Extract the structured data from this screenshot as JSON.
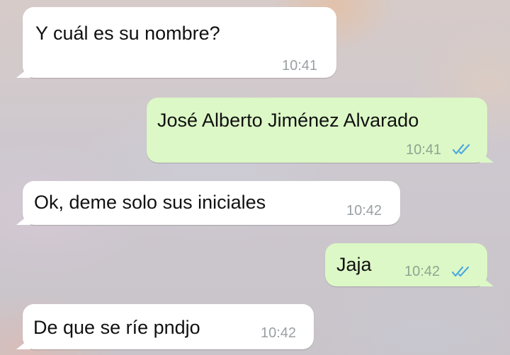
{
  "messages": [
    {
      "direction": "incoming",
      "text": "Y cuál es su nombre?",
      "time": "10:41"
    },
    {
      "direction": "outgoing",
      "text": "José Alberto Jiménez Alvarado",
      "time": "10:41",
      "status_icon": "double-check-read-icon"
    },
    {
      "direction": "incoming",
      "text": "Ok, deme solo sus iniciales",
      "time": "10:42"
    },
    {
      "direction": "outgoing",
      "text": "Jaja",
      "time": "10:42",
      "status_icon": "double-check-read-icon"
    },
    {
      "direction": "incoming",
      "text": "De que se ríe pndjo",
      "time": "10:42"
    }
  ],
  "colors": {
    "incoming_bubble": "#ffffff",
    "outgoing_bubble": "#dcf8c6",
    "read_ticks": "#4fa8e0"
  }
}
